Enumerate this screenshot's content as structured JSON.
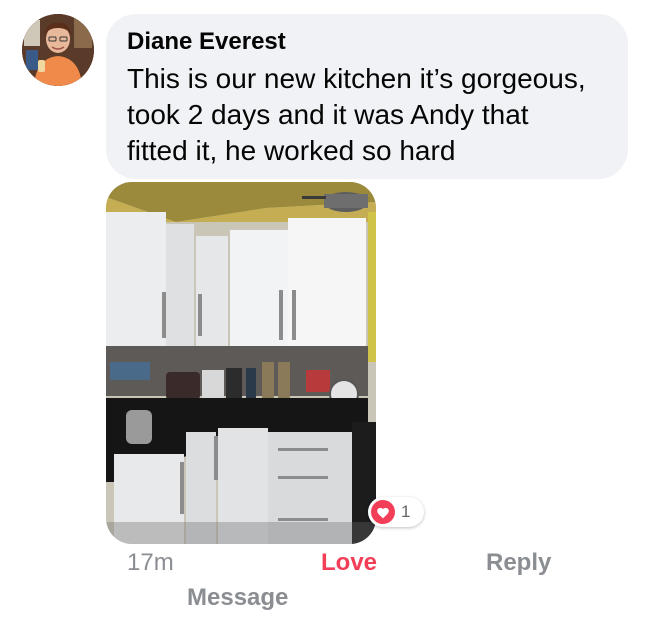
{
  "comment": {
    "author": "Diane Everest",
    "text": "This is our new kitchen it’s gorgeous,\ntook 2 days and it was Andy that\nfitted it, he worked so hard",
    "avatar_icon": "profile-photo",
    "attachment": "kitchen-photo"
  },
  "reactions": {
    "icon": "heart-icon",
    "count": "1",
    "color": "#f33e58"
  },
  "actions": {
    "timestamp": "17m",
    "love_label": "Love",
    "reply_label": "Reply",
    "message_label": "Message"
  },
  "colors": {
    "bubble_bg": "#f0f2f5",
    "love": "#f33e58",
    "secondary_text": "#8a8d91",
    "primary_text": "#050505"
  }
}
